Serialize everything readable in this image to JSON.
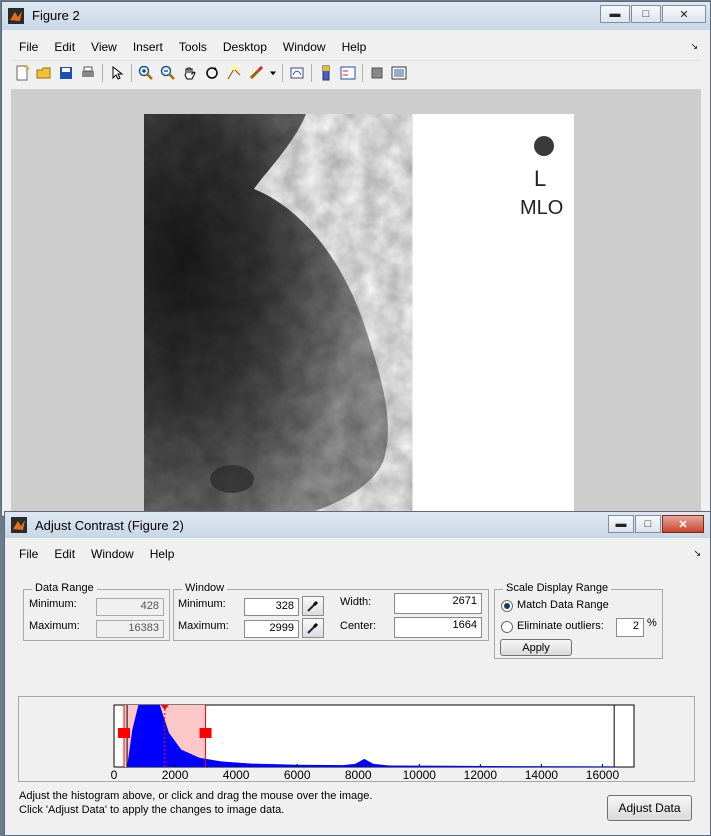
{
  "figure_window": {
    "title": "Figure 2",
    "menu": [
      "File",
      "Edit",
      "View",
      "Insert",
      "Tools",
      "Desktop",
      "Window",
      "Help"
    ],
    "toolbar_icons": [
      "new-figure-icon",
      "open-file-icon",
      "save-icon",
      "print-icon",
      "edit-plot-icon",
      "zoom-in-icon",
      "zoom-out-icon",
      "pan-icon",
      "rotate-3d-icon",
      "data-cursor-icon",
      "brush-icon",
      "brush-dropdown-icon",
      "link-plot-icon",
      "colorbar-icon",
      "legend-icon",
      "hide-plot-tools-icon",
      "show-plot-tools-icon"
    ],
    "image_labels": {
      "side": "L",
      "view": "MLO"
    }
  },
  "contrast_window": {
    "title": "Adjust Contrast (Figure 2)",
    "menu": [
      "File",
      "Edit",
      "Window",
      "Help"
    ],
    "data_range": {
      "legend": "Data Range",
      "min_label": "Minimum:",
      "min_value": "428",
      "max_label": "Maximum:",
      "max_value": "16383"
    },
    "window": {
      "legend": "Window",
      "min_label": "Minimum:",
      "min_value": "328",
      "max_label": "Maximum:",
      "max_value": "2999",
      "width_label": "Width:",
      "width_value": "2671",
      "center_label": "Center:",
      "center_value": "1664"
    },
    "scale": {
      "legend": "Scale Display Range",
      "match_label": "Match Data Range",
      "outliers_label": "Eliminate outliers:",
      "outliers_value": "2",
      "percent": "%",
      "apply_label": "Apply",
      "selected": "match"
    },
    "histogram": {
      "xmin": 0,
      "xmax": 17000,
      "ticks": [
        "0",
        "2000",
        "4000",
        "6000",
        "8000",
        "10000",
        "12000",
        "14000",
        "16000"
      ],
      "window_min": 328,
      "window_max": 2999,
      "data_min": 428,
      "data_max": 16383,
      "color": "#0000ff",
      "window_color": "#ffc8c8",
      "marker_color": "#ff0000"
    },
    "instructions": [
      "Adjust the histogram above, or click and drag the mouse over the image.",
      "Click 'Adjust Data' to apply the changes to image data."
    ],
    "adjust_button": "Adjust Data"
  }
}
